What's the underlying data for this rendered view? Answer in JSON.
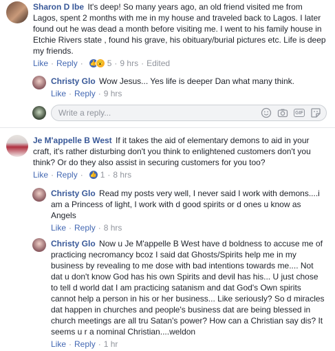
{
  "comments": [
    {
      "author": "Sharon D Ibe",
      "text": "It's deep! So many years ago, an old friend visited me from Lagos, spent 2 months with me in my house and traveled back to Lagos. I later found out he was dead a month before visiting me. I went to his family house in Etchie Rivers state , found his grave, his obituary/burial pictures etc. Life is deep my friends.",
      "like": "Like",
      "reply": "Reply",
      "reaction_count": "5",
      "time": "9 hrs",
      "edited": "Edited"
    },
    {
      "author": "Christy Glo",
      "text": "Wow Jesus... Yes life is deeper Dan what many think.",
      "like": "Like",
      "reply": "Reply",
      "time": "9 hrs"
    },
    {
      "author": "Je M'appelle B West",
      "text": "If it takes the aid of elementary demons to aid in your craft, it's rather disturbing don't you think to enlightened customers don't you think? Or do they also assist in securing customers for you too?",
      "like": "Like",
      "reply": "Reply",
      "reaction_count": "1",
      "time": "8 hrs"
    },
    {
      "author": "Christy Glo",
      "text": "Read my posts very well, I never said I work with demons....i am a Princess of light, I work with d good spirits or d ones u know as Angels",
      "like": "Like",
      "reply": "Reply",
      "time": "8 hrs"
    },
    {
      "author": "Christy Glo",
      "text": "Now u Je M'appelle B West have d boldness to accuse me of practicing necromancy bcoz I said dat Ghosts/Spirits help me in my business by revealing to me dose with bad intentions towards me.... Not dat u don't know God has his own Spirits and devil has his... U just chose to tell d world dat I am practicing satanism and dat God's Own spirits cannot help a person in his or her business... Like seriously? So d miracles dat happen in churches and people's business dat are being blessed in church meetings are all tru Satan's power? How can a Christian say dis? It seems u r a nominal Christian....weldon",
      "like": "Like",
      "reply": "Reply",
      "time": "1 hr"
    }
  ],
  "reply_box": {
    "placeholder": "Write a reply..."
  },
  "colors": {
    "link": "#385898",
    "action": "#4267b2",
    "meta": "#90949c"
  }
}
